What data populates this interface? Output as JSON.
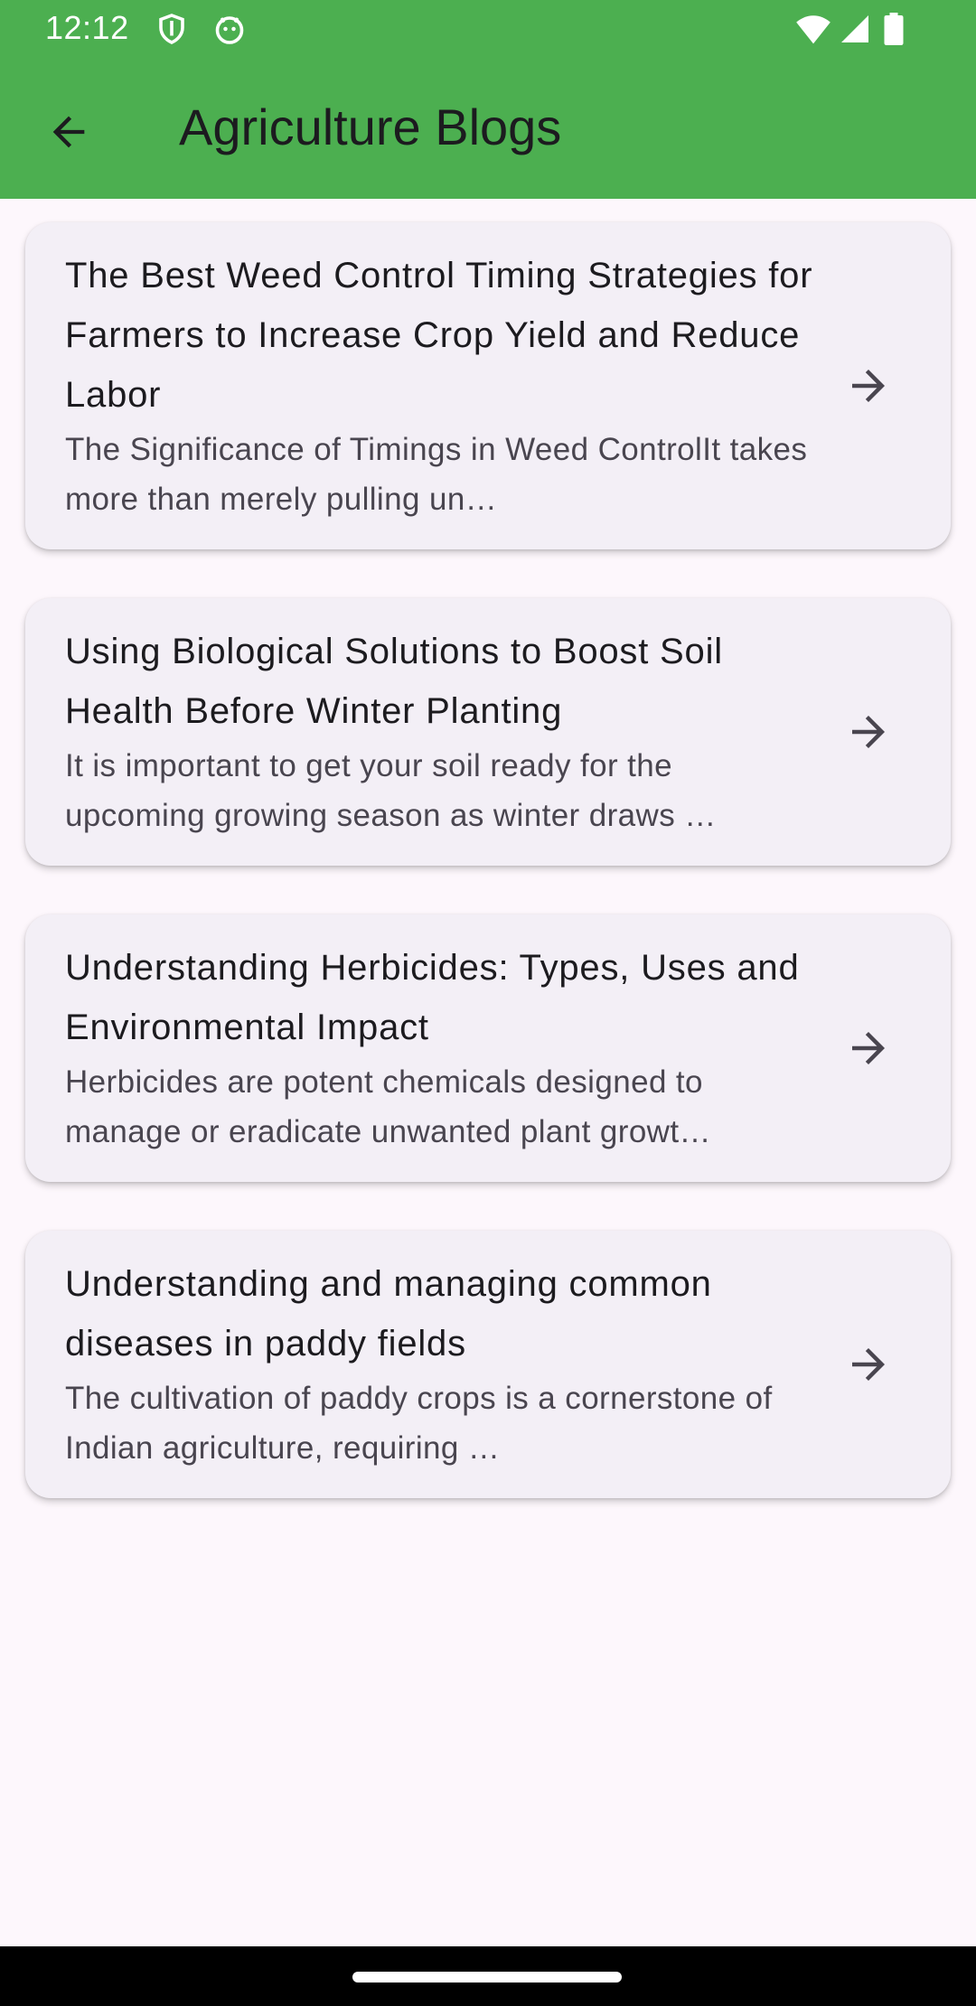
{
  "status_bar": {
    "time": "12:12",
    "icons": [
      "shield-icon",
      "android-icon",
      "wifi-icon",
      "signal-icon",
      "battery-icon"
    ]
  },
  "app_bar": {
    "title": "Agriculture Blogs",
    "back_icon": "arrow-back-icon",
    "color": "#4caf50"
  },
  "blogs": [
    {
      "title": "The Best Weed Control Timing Strategies for Farmers to Increase Crop Yield and Reduce Labor",
      "excerpt": "The Significance of Timings in Weed ControlIt takes more than merely pulling un…",
      "icon": "arrow-forward-icon"
    },
    {
      "title": "Using Biological Solutions to Boost Soil Health Before Winter Planting",
      "excerpt": "It is important to get your soil ready for the upcoming growing season as winter draws …",
      "icon": "arrow-forward-icon"
    },
    {
      "title": "Understanding Herbicides: Types, Uses and Environmental Impact",
      "excerpt": "Herbicides are potent chemicals designed to manage or eradicate unwanted plant growt…",
      "icon": "arrow-forward-icon"
    },
    {
      "title": "Understanding and managing common diseases in paddy fields",
      "excerpt": "The cultivation of paddy crops is a cornerstone of Indian agriculture, requiring …",
      "icon": "arrow-forward-icon"
    }
  ]
}
